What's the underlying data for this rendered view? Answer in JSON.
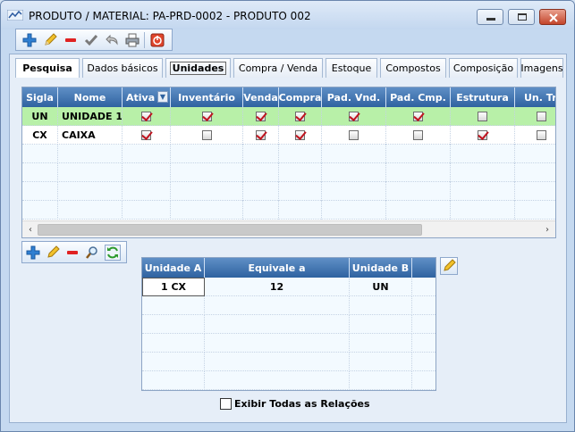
{
  "window": {
    "title": "PRODUTO / MATERIAL: PA-PRD-0002 - PRODUTO 002",
    "controls": {
      "minimize_icon": "minimize-icon",
      "maximize_icon": "maximize-icon",
      "close_icon": "close-icon"
    }
  },
  "toolbar": {
    "icons": [
      "add-icon",
      "edit-pencil-icon",
      "remove-icon",
      "confirm-check-icon",
      "undo-icon",
      "print-icon",
      "power-exit-icon"
    ]
  },
  "tabs": [
    {
      "label": "Pesquisa"
    },
    {
      "label": "Dados básicos"
    },
    {
      "label": "Unidades"
    },
    {
      "label": "Compra / Venda"
    },
    {
      "label": "Estoque"
    },
    {
      "label": "Compostos"
    },
    {
      "label": "Composição"
    },
    {
      "label": "Imagens"
    }
  ],
  "units_grid": {
    "columns": [
      "Sigla",
      "Nome",
      "Ativa",
      "Inventário",
      "Venda",
      "Compra",
      "Pad. Vnd.",
      "Pad. Cmp.",
      "Estrutura",
      "Un. Tr"
    ],
    "rows": [
      {
        "sigla": "UN",
        "nome": "UNIDADE 1",
        "checks": [
          true,
          true,
          true,
          true,
          true,
          true,
          false,
          false
        ]
      },
      {
        "sigla": "CX",
        "nome": "CAIXA",
        "checks": [
          true,
          false,
          true,
          true,
          false,
          false,
          true,
          false
        ]
      }
    ],
    "empty_rows": 4
  },
  "toolbar2": {
    "icons": [
      "add-icon",
      "edit-pencil-icon",
      "remove-icon",
      "search-magnifier-icon",
      "refresh-icon"
    ]
  },
  "relations_grid": {
    "columns": [
      "Unidade A",
      "Equivale a",
      "Unidade B"
    ],
    "rows": [
      {
        "a": "1 CX",
        "eq": "12",
        "b": "UN"
      }
    ],
    "empty_rows": 5
  },
  "show_all": {
    "label": "Exibir Todas as Relações",
    "checked": false
  },
  "colors": {
    "header_blue": "#2f62a0",
    "selected_row": "#b8f0a8",
    "check_red": "#c0141f"
  }
}
